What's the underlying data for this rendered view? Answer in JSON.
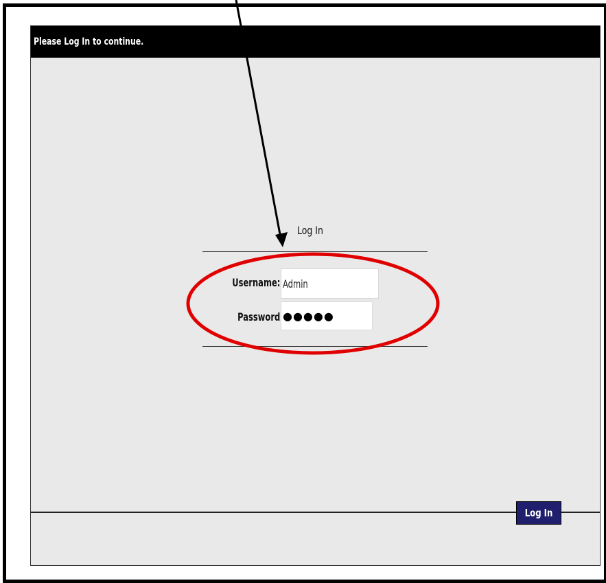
{
  "dialog": {
    "title": "Please Log In to continue."
  },
  "form": {
    "heading": "Log In",
    "username_label": "Username:",
    "username_value": "Admin",
    "password_label": "Password",
    "password_mask": "●●●●●"
  },
  "footer": {
    "login_button_label": "Log In"
  },
  "annotations": {
    "arrow_color": "#000000",
    "highlight_ellipse_color": "#e00000"
  }
}
